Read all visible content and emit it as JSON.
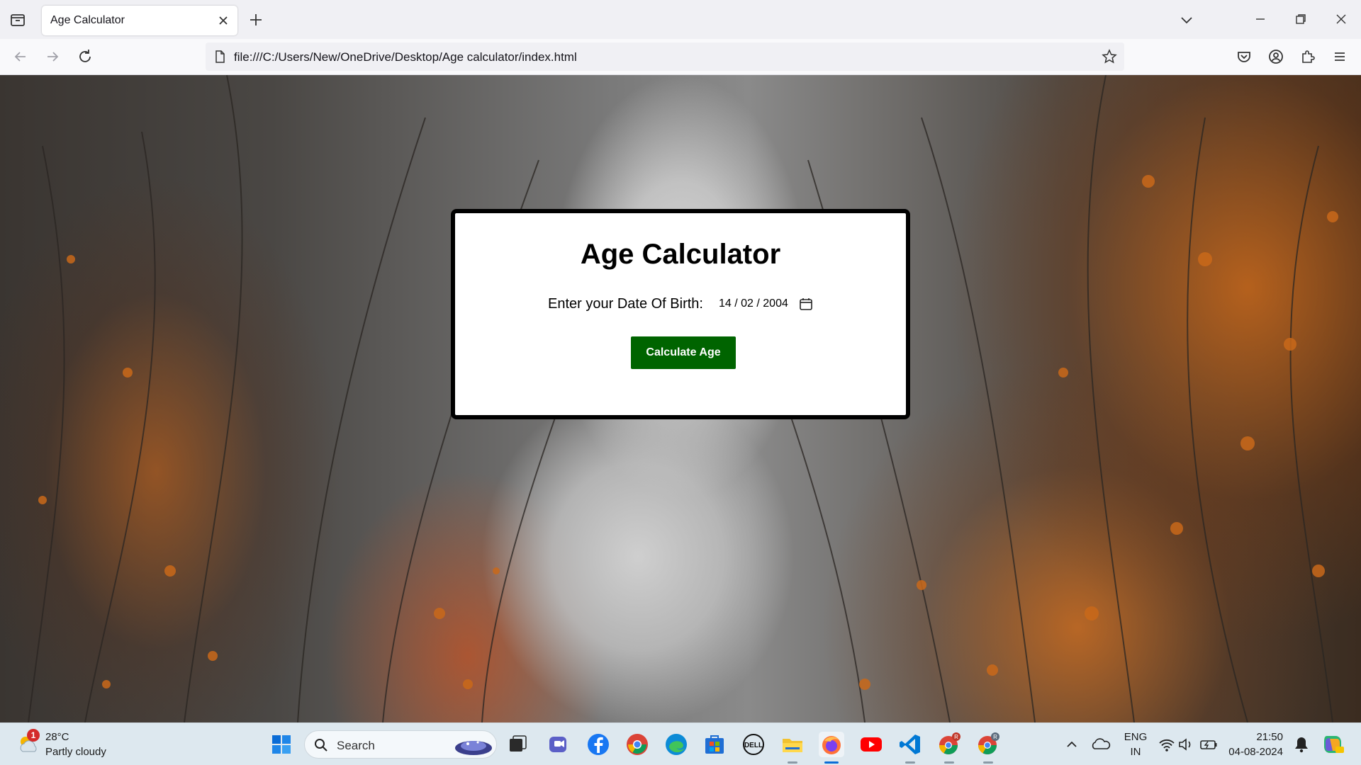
{
  "browser": {
    "tab_title": "Age Calculator",
    "url": "file:///C:/Users/New/OneDrive/Desktop/Age calculator/index.html"
  },
  "page": {
    "title": "Age Calculator",
    "dob_label": "Enter your Date Of Birth:",
    "dob_value": "14 / 02 / 2004",
    "button_label": "Calculate Age",
    "colors": {
      "button_bg": "#006400",
      "card_border": "#000000"
    }
  },
  "taskbar": {
    "weather_temp": "28°C",
    "weather_desc": "Partly cloudy",
    "weather_badge": "1",
    "search_label": "Search",
    "language_line1": "ENG",
    "language_line2": "IN",
    "time": "21:50",
    "date": "04-08-2024",
    "pinned_apps": [
      "windows-start-icon",
      "task-view-icon",
      "teams-icon",
      "facebook-icon",
      "chrome-icon",
      "edge-icon",
      "microsoft-store-icon",
      "dell-icon",
      "file-explorer-icon",
      "firefox-icon",
      "youtube-icon",
      "vscode-icon",
      "chrome-profile-icon",
      "chrome-profile-2-icon"
    ]
  }
}
